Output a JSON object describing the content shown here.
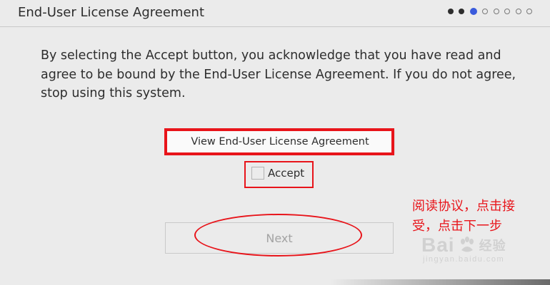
{
  "header": {
    "title": "End-User License Agreement",
    "progress": {
      "total": 8,
      "current": 3
    }
  },
  "main": {
    "message": "By selecting the Accept button, you acknowledge that you have read and agree to be bound by the End-User License Agreement. If you do not agree, stop using this system.",
    "view_button_label": "View End-User License Agreement",
    "accept_label": "Accept",
    "accept_checked": false,
    "next_label": "Next",
    "next_enabled": false
  },
  "overlay": {
    "annotation": "阅读协议，点击接受，点击下一步",
    "highlight_color": "#e8141a",
    "watermark_brand": "Bai",
    "watermark_brand_2": "经验",
    "watermark_url": "jingyan.baidu.com"
  },
  "colors": {
    "background": "#ebebeb",
    "accent": "#3a5bdc",
    "text": "#2d2d2d",
    "disabled_text": "#a3a3a3"
  }
}
